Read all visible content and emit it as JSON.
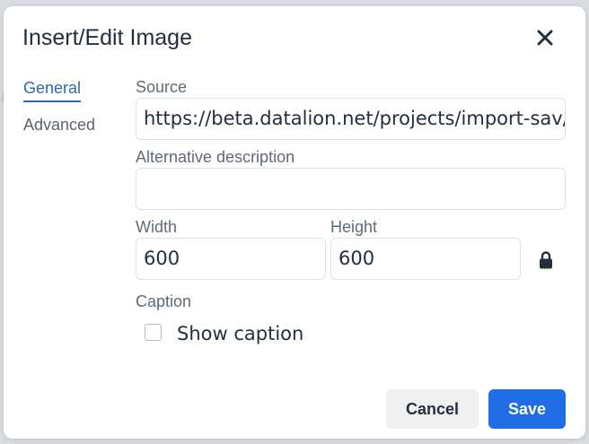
{
  "dialog": {
    "title": "Insert/Edit Image",
    "close_icon": "close-icon"
  },
  "tabs": [
    {
      "label": "General",
      "active": true
    },
    {
      "label": "Advanced",
      "active": false
    }
  ],
  "fields": {
    "source": {
      "label": "Source",
      "value": "https://beta.datalion.net/projects/import-sav/me"
    },
    "alt": {
      "label": "Alternative description",
      "value": ""
    },
    "width": {
      "label": "Width",
      "value": "600"
    },
    "height": {
      "label": "Height",
      "value": "600"
    },
    "lock_icon": "lock-icon"
  },
  "caption": {
    "label": "Caption",
    "checkbox_label": "Show caption",
    "checked": false
  },
  "buttons": {
    "cancel": "Cancel",
    "save": "Save"
  },
  "colors": {
    "accent": "#206ee3",
    "tab_active": "#2a6bb4",
    "text": "#222f3e"
  }
}
